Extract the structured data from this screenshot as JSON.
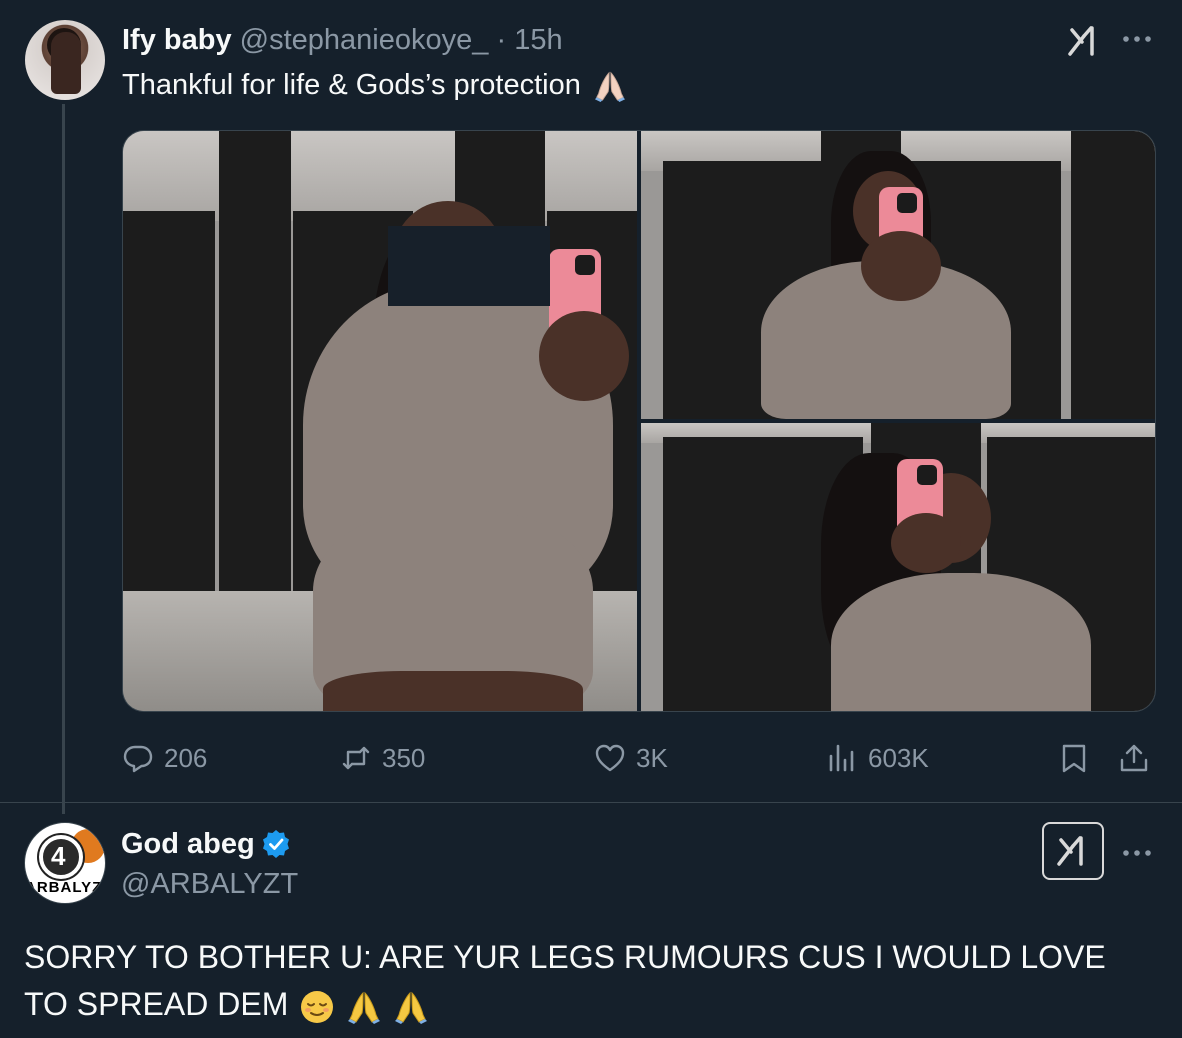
{
  "tweet1": {
    "display_name": "Ify baby",
    "handle": "@stephanieokoye_",
    "separator": "·",
    "time": "15h",
    "text": "Thankful for life & Gods’s protection",
    "emoji": "folded-hands-light-skin",
    "stats": {
      "replies": "206",
      "reposts": "350",
      "likes": "3K",
      "views": "603K"
    }
  },
  "tweet2": {
    "display_name": "God abeg",
    "handle": "@ARBALYZT",
    "avatar_text": "ARBALYZT",
    "avatar_number": "4",
    "verified": true,
    "text": "SORRY TO BOTHER U: ARE YUR LEGS RUMOURS CUS I WOULD LOVE TO SPREAD DEM",
    "emojis": [
      "relieved-face",
      "folded-hands",
      "folded-hands"
    ]
  },
  "icons": {
    "reply": "reply-icon",
    "repost": "repost-icon",
    "like": "heart-icon",
    "views": "views-icon",
    "bookmark": "bookmark-icon",
    "share": "share-icon",
    "grok": "grok-icon",
    "more": "more-icon"
  },
  "colors": {
    "background": "#15202b",
    "text": "#f7f9f9",
    "secondary": "#8b98a5",
    "border": "#38444d",
    "verified": "#1d9bf0"
  }
}
